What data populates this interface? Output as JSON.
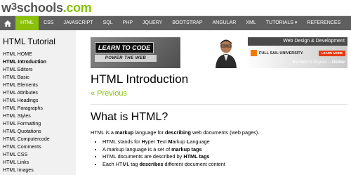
{
  "logo": {
    "w": "w",
    "num": "3",
    "rest": "schools",
    "com": ".com"
  },
  "topnav": {
    "home_icon": "home-icon",
    "items": [
      "HTML",
      "CSS",
      "JAVASCRIPT",
      "SQL",
      "PHP",
      "JQUERY",
      "BOOTSTRAP",
      "ANGULAR",
      "XML",
      "TUTORIALS ▾",
      "REFERENCES"
    ],
    "active_index": 0,
    "active_color": "#8AC007",
    "bar_color": "#5f5f5f"
  },
  "sidebar": {
    "title": "HTML Tutorial",
    "items": [
      "HTML HOME",
      "HTML Introduction",
      "HTML Editors",
      "HTML Basic",
      "HTML Elements",
      "HTML Attributes",
      "HTML Headings",
      "HTML Paragraphs",
      "HTML Styles",
      "HTML Formatting",
      "HTML Quotations",
      "HTML Computercode",
      "HTML Comments",
      "HTML CSS",
      "HTML Links",
      "HTML Images"
    ],
    "active_index": 1
  },
  "banner": {
    "learn": "LEARN TO CODE",
    "power": "POWER THE WEB",
    "ad_title": "Web Design & Development",
    "school": "FULL SAIL UNIVERSITY.",
    "learn_more": "LEARN MORE",
    "degree_a": "Bachelor's Degree – ",
    "degree_b": "Online"
  },
  "main": {
    "title": "HTML Introduction",
    "prev": "« Previous",
    "section_title": "What is HTML?",
    "intro": {
      "t1": "HTML is a ",
      "b1": "markup",
      "t2": " language for ",
      "b2": "describing",
      "t3": " web documents (web pages)."
    },
    "bullets": [
      {
        "parts": [
          [
            "HTML stands for ",
            false
          ],
          [
            "H",
            true
          ],
          [
            "yper ",
            false
          ],
          [
            "T",
            true
          ],
          [
            "ext ",
            false
          ],
          [
            "M",
            true
          ],
          [
            "arkup ",
            false
          ],
          [
            "L",
            true
          ],
          [
            "anguage",
            false
          ]
        ]
      },
      {
        "parts": [
          [
            "A markup language is a set of ",
            false
          ],
          [
            "markup tags",
            true
          ]
        ]
      },
      {
        "parts": [
          [
            "HTML documents are described by ",
            false
          ],
          [
            "HTML tags",
            true
          ]
        ]
      },
      {
        "parts": [
          [
            "Each HTML tag ",
            false
          ],
          [
            "describes",
            true
          ],
          [
            " different document content",
            false
          ]
        ]
      }
    ]
  }
}
